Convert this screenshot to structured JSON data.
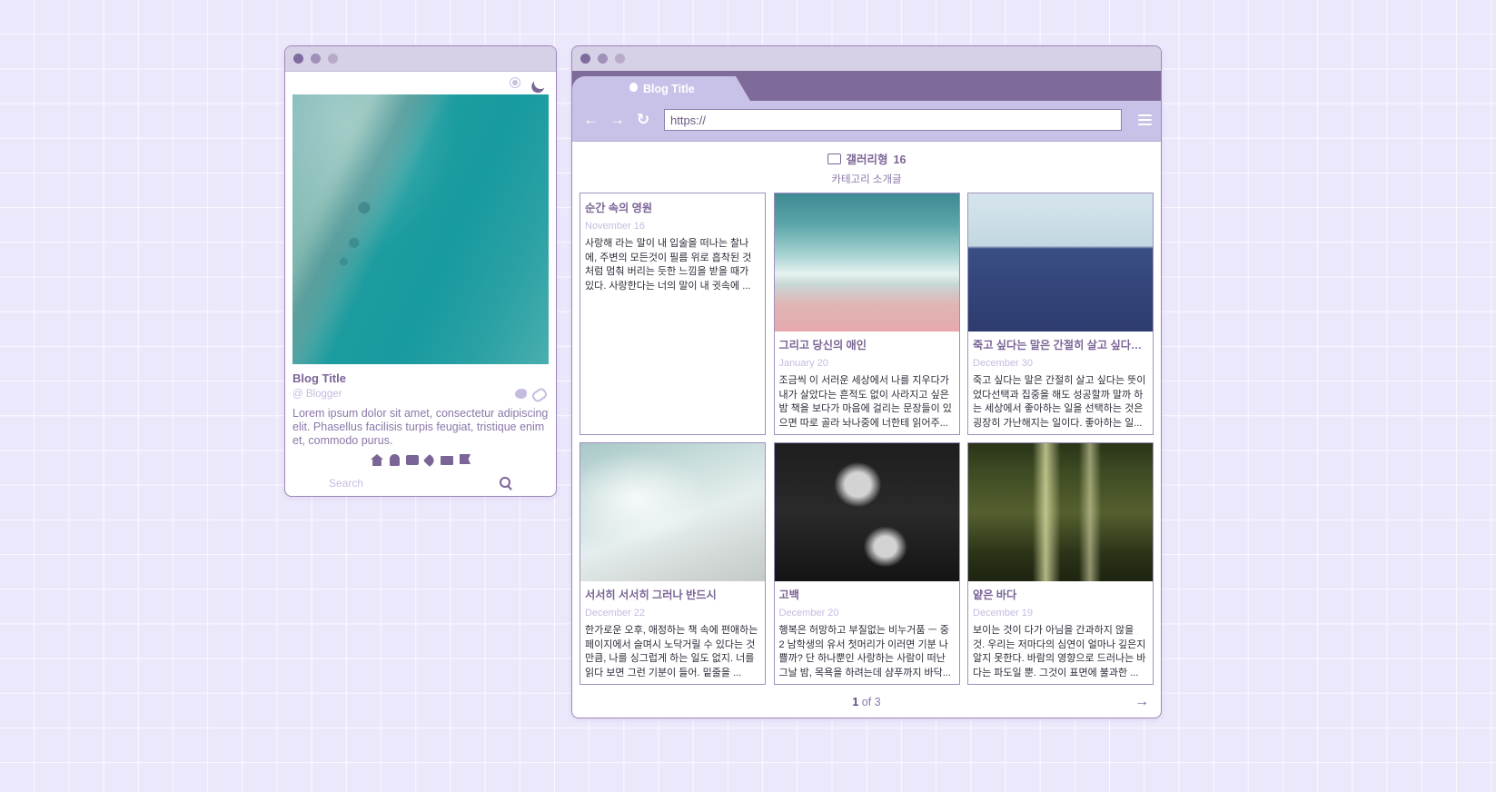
{
  "left_window": {
    "blog_title": "Blog Title",
    "blogger": "@ Blogger",
    "description": "Lorem ipsum dolor sit amet, consectetur adipiscing elit. Phasellus facilisis turpis feugiat, tristique enim et, commodo purus.",
    "search_placeholder": "Search",
    "icons": [
      "sun-icon",
      "moon-icon",
      "twitter-icon",
      "link-icon",
      "home-icon",
      "bell-icon",
      "folder-icon",
      "tag-icon",
      "mail-icon",
      "flag-icon",
      "search-icon"
    ]
  },
  "browser": {
    "tab_label": "Blog Title",
    "url": "https://"
  },
  "category": {
    "name": "갤러리형",
    "count": "16",
    "subtitle": "카테고리 소개글"
  },
  "posts": [
    {
      "title": "순간 속의 영원",
      "date": "November 16",
      "excerpt": "사랑해 라는 말이 내 입술을 떠나는 찰나에, 주변의 모든것이 필름 위로 흡착된 것처럼 멈춰 버리는 듯한 느낌을 받을 때가 있다. 사랑한다는 너의 말이 내 귓속에 ..."
    },
    {
      "title": "그리고 당신의 애인",
      "date": "January 20",
      "excerpt": "조금씩 이 서러운 세상에서 나를 지우다가 내가 살았다는 흔적도 없이 사라지고 싶은 밤 책을 보다가 마음에 걸리는 문장들이 있으면 따로 골라 놔나중에 너한테 읽어주..."
    },
    {
      "title": "죽고 싶다는 말은 간절히 살고 싶다는 뜻이었다",
      "date": "December 30",
      "excerpt": "죽고 싶다는 말은 간절히 살고 싶다는 뜻이었다선택과 집중을 해도 성공할까 말까 하는 세상에서 좋아하는 일을 선택하는 것은 굉장히 가난해지는 일이다. 좋아하는 일..."
    },
    {
      "title": "서서히 서서히 그러나 반드시",
      "date": "December 22",
      "excerpt": "한가로운 오후, 애정하는 책 속에 편애하는 페이지에서 슬며시 노닥거릴 수 있다는 것만큼, 나를 싱그럽게 하는 일도 없지. 너를 읽다 보면 그런 기분이 들어. 밑줄을 ..."
    },
    {
      "title": "고백",
      "date": "December 20",
      "excerpt": "행복은 허망하고 부질없는 비누거품 ㅡ 중2 남학생의 유서 첫머리가 이러면 기분 나쁠까? 단 하나뿐인 사랑하는 사람이 떠난 그날 밤, 목욕을 하려는데 샴푸까지 바닥..."
    },
    {
      "title": "얕은 바다",
      "date": "December 19",
      "excerpt": "보이는 것이 다가 아님을 간과하지 않을 것. 우리는 저마다의 심연이 얼마나 깊은지 알지 못한다. 바람의 영향으로 드러나는 바다는 파도일 뿐. 그것이 표면에 불과한 ..."
    }
  ],
  "pagination": {
    "current": "1",
    "of_total": "of 3"
  },
  "colors": {
    "accent": "#7b6596",
    "tab_strip": "#7f6b99",
    "nav_bar": "#c9c2e8",
    "muted": "#c7bbe0"
  }
}
